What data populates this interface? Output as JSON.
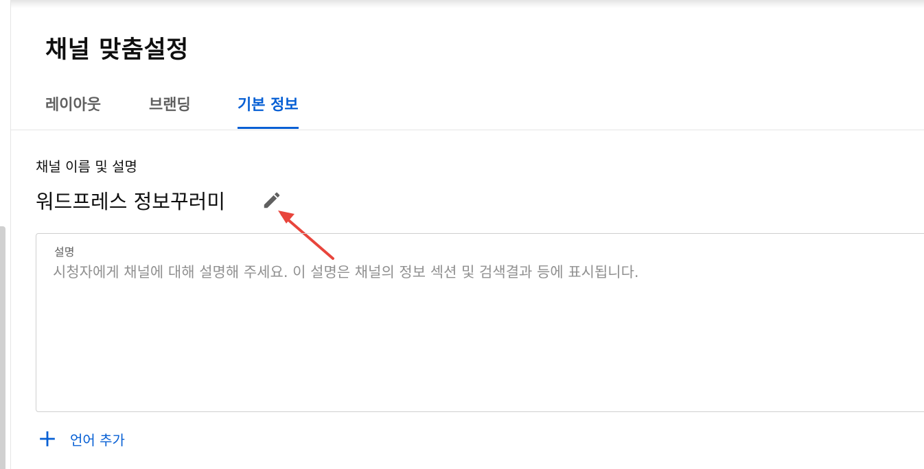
{
  "page": {
    "title": "채널 맞춤설정"
  },
  "tabs": [
    {
      "label": "레이아웃",
      "active": false
    },
    {
      "label": "브랜딩",
      "active": false
    },
    {
      "label": "기본 정보",
      "active": true
    }
  ],
  "basic_info": {
    "section_label": "채널 이름 및 설명",
    "channel_name": "워드프레스 정보꾸러미",
    "edit_icon": "pencil-icon",
    "description": {
      "label": "설명",
      "value": "",
      "placeholder": "시청자에게 채널에 대해 설명해 주세요. 이 설명은 채널의 정보 섹션 및 검색결과 등에 표시됩니다."
    },
    "add_language": {
      "icon": "plus-icon",
      "label": "언어 추가"
    }
  },
  "colors": {
    "accent": "#065fd4",
    "text_primary": "#0f0f0f",
    "text_secondary": "#606060",
    "annotation_arrow": "#e8453c"
  }
}
